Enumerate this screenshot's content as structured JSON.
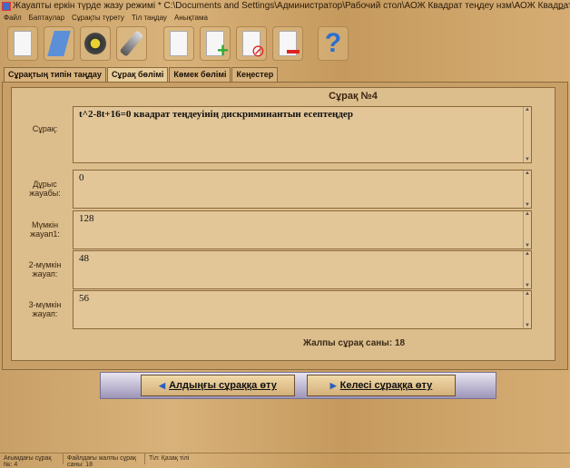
{
  "window": {
    "title": "Жауапты еркін түрде жазу режимі * C:\\Documents and Settings\\Администратор\\Рабочий стол\\АОЖ Квадрат теңдеу нзм\\АОЖ Квадрат теңдеу нзм\\...",
    "minimize": "_"
  },
  "menu": [
    "Файл",
    "Баптаулар",
    "Сұрақты түрету",
    "Тіл таңдау",
    "Анықтама"
  ],
  "toolbar": [
    {
      "icon": "new-file-icon"
    },
    {
      "icon": "open-folder-icon"
    },
    {
      "icon": "save-disk-icon"
    },
    {
      "icon": "usb-drive-icon"
    },
    {
      "icon": "edit-document-icon"
    },
    {
      "icon": "add-document-icon"
    },
    {
      "icon": "cancel-document-icon"
    },
    {
      "icon": "remove-document-icon"
    },
    {
      "icon": "help-icon"
    }
  ],
  "tabs": [
    {
      "label": "Сұрақтың типін таңдау"
    },
    {
      "label": "Сұрақ бөлімі",
      "active": true
    },
    {
      "label": "Көмек бөлімі"
    },
    {
      "label": "Кеңестер"
    }
  ],
  "main": {
    "heading": "Сұрақ №4",
    "fields": [
      {
        "label": "Сұрақ:",
        "value": "t^2-8t+16=0  квадрат теңдеуінің дискриминантын есептеңдер"
      },
      {
        "label": "Дұрыс жауабы:",
        "value": "0"
      },
      {
        "label": "Мүмкін жауап1:",
        "value": "128"
      },
      {
        "label": "2-мүмкін жауап:",
        "value": "48"
      },
      {
        "label": "3-мүмкін жауап:",
        "value": "56"
      }
    ],
    "total": "Жалпы сұрақ саны: 18"
  },
  "nav": {
    "prev": "Алдыңғы сұраққа өту",
    "next": "Келесі сұраққа өту"
  },
  "status": [
    "Ағымдағы сұрақ №: 4",
    "Файлдағы жалпы сұрақ саны: 18",
    "Тіл: Қазақ тілі"
  ]
}
